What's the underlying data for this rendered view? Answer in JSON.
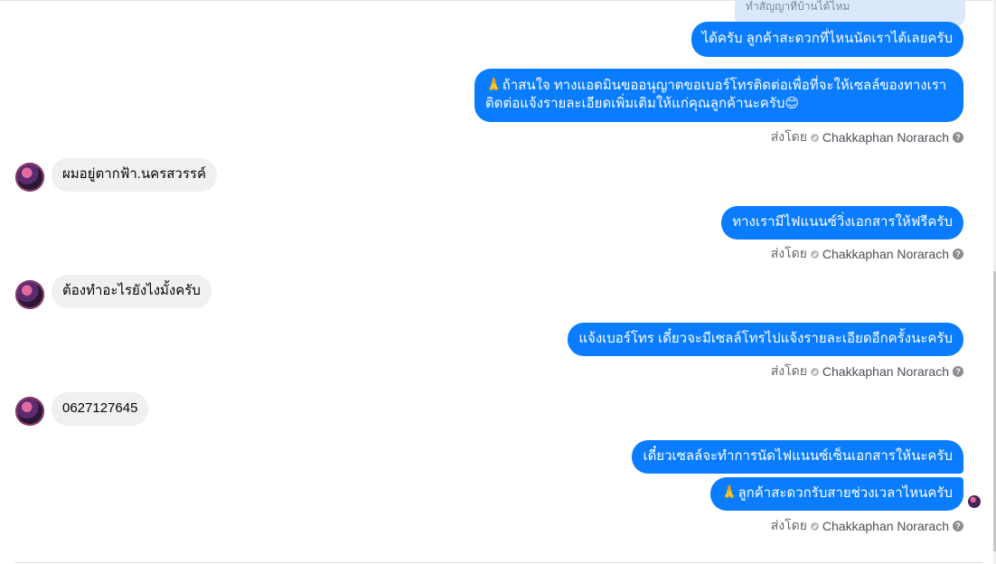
{
  "quoted_preview": "ทำสัญญาที่บ้านได้ไหม",
  "sender_prefix": "ส่งโดย",
  "sender_name": "Chakkaphan Norarach",
  "help_glyph": "?",
  "messages": [
    {
      "side": "out",
      "text": "ได้ครับ ลูกค้าสะดวกที่ไหนนัดเราได้เลยครับ"
    },
    {
      "side": "out",
      "lines": [
        "🙏ถ้าสนใจ ทางแอดมินขออนุญาตขอเบอร์โทรติดต่อเพื่อที่จะให้เซลล์ของทางเรา",
        "ติดต่อแจ้งรายละเอียดเพิ่มเติมให้แก่คุณลูกค้านะครับ😊"
      ]
    },
    {
      "side": "in",
      "text": "ผมอยู่ตากฟ้า.นครสวรรค์"
    },
    {
      "side": "out",
      "text": "ทางเรามีไฟแนนซ์วิ่งเอกสารให้ฟรีครับ"
    },
    {
      "side": "in",
      "text": "ต้องทำอะไรยังไงมั้งครับ"
    },
    {
      "side": "out",
      "text": "แจ้งเบอร์โทร เดี๋ยวจะมีเซลล์โทรไปแจ้งรายละเอียดอีกครั้งนะครับ"
    },
    {
      "side": "in",
      "text": "0627127645"
    },
    {
      "side": "out",
      "text": "เดี๋ยวเซลล์จะทำการนัดไฟแนนซ์เซ็นเอกสารให้นะครับ"
    },
    {
      "side": "out",
      "text": "🙏ลูกค้าสะดวกรับสายช่วงเวลาไหนครับ"
    }
  ],
  "colors": {
    "outgoing": "#0a7cff",
    "incoming": "#f0f0f0",
    "meta": "#65676b"
  }
}
